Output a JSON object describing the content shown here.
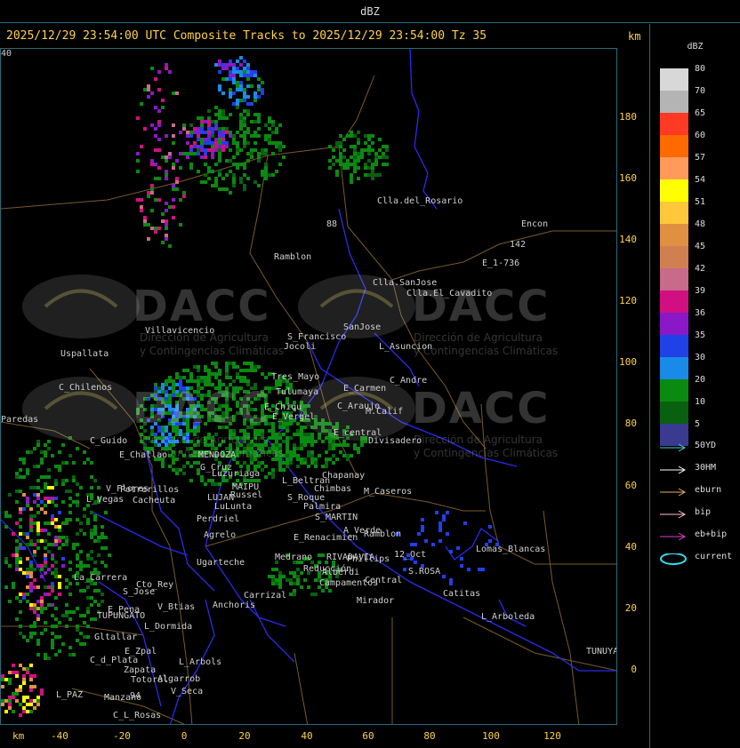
{
  "top_title": "dBZ",
  "header": {
    "title": "2025/12/29 23:54:00 UTC Composite Tracks to 2025/12/29 23:54:00 Tz 35",
    "km": "km"
  },
  "axes": {
    "x_unit": "km",
    "x_ticks": [
      "-40",
      "-20",
      "0",
      "20",
      "40",
      "60",
      "80",
      "100",
      "120"
    ],
    "y_ticks": [
      "180",
      "160",
      "140",
      "120",
      "100",
      "80",
      "60",
      "40",
      "20",
      "0"
    ]
  },
  "colorbar": {
    "title": "dBZ",
    "levels": [
      {
        "label": "80",
        "color": "#d8d8d8"
      },
      {
        "label": "70",
        "color": "#b4b4b4"
      },
      {
        "label": "65",
        "color": "#ff3a24"
      },
      {
        "label": "60",
        "color": "#ff6a00"
      },
      {
        "label": "57",
        "color": "#ff9a5a"
      },
      {
        "label": "54",
        "color": "#ffff00"
      },
      {
        "label": "51",
        "color": "#ffc83a"
      },
      {
        "label": "48",
        "color": "#e09040"
      },
      {
        "label": "45",
        "color": "#d08050"
      },
      {
        "label": "42",
        "color": "#c86a8a"
      },
      {
        "label": "39",
        "color": "#d01080"
      },
      {
        "label": "36",
        "color": "#8a18c8"
      },
      {
        "label": "35",
        "color": "#2040e8"
      },
      {
        "label": "30",
        "color": "#1a8ae8"
      },
      {
        "label": "20",
        "color": "#0a8a10"
      },
      {
        "label": "10",
        "color": "#096010"
      },
      {
        "label": "5",
        "color": "#3a3a90"
      }
    ]
  },
  "legend": [
    {
      "label": "50YD",
      "color": "#40d0e0",
      "kind": "arrow"
    },
    {
      "label": "30HM",
      "color": "#ffffff",
      "kind": "arrow"
    },
    {
      "label": "eburn",
      "color": "#e8b060",
      "kind": "arrow"
    },
    {
      "label": "bip",
      "color": "#ffc0d0",
      "kind": "arrow"
    },
    {
      "label": "eb+bip",
      "color": "#e040e0",
      "kind": "arrow"
    },
    {
      "label": "current",
      "color": "#30e0f0",
      "kind": "ellipse"
    }
  ],
  "watermark": {
    "brand": "DACC",
    "line1": "Dirección de Agricultura",
    "line2": "y Contingencias Climáticas"
  },
  "places": [
    {
      "name": "Clla.del_Rosario"
    },
    {
      "name": "Encon"
    },
    {
      "name": "142"
    },
    {
      "name": "E_1-736"
    },
    {
      "name": "Ramblon"
    },
    {
      "name": "Clla.SanJose"
    },
    {
      "name": "Clla.El_Cavadito"
    },
    {
      "name": "Villavicencio"
    },
    {
      "name": "S_Francisco"
    },
    {
      "name": "SanJose"
    },
    {
      "name": "L_Asuncion"
    },
    {
      "name": "Uspallata"
    },
    {
      "name": "Jocoli"
    },
    {
      "name": "Tres_Mayo"
    },
    {
      "name": "C_Andre"
    },
    {
      "name": "E_Carmen"
    },
    {
      "name": "Tulumaya"
    },
    {
      "name": "C_Chilenos"
    },
    {
      "name": "C_Araujo"
    },
    {
      "name": "E_Chiqu"
    },
    {
      "name": "M.Calif"
    },
    {
      "name": "E_Vergel"
    },
    {
      "name": "Paredas"
    },
    {
      "name": "E_central"
    },
    {
      "name": "Divisadero"
    },
    {
      "name": "C_Guido"
    },
    {
      "name": "E_Challao"
    },
    {
      "name": "MENDOZA"
    },
    {
      "name": "G_Cruz"
    },
    {
      "name": "Luzuriaga"
    },
    {
      "name": "L_Beltran"
    },
    {
      "name": "Chimbas"
    },
    {
      "name": "M_Caseros"
    },
    {
      "name": "Chapanay"
    },
    {
      "name": "Potrerillos"
    },
    {
      "name": "Cacheuta"
    },
    {
      "name": "L_Vegas"
    },
    {
      "name": "MAIPU"
    },
    {
      "name": "LUJAN"
    },
    {
      "name": "Russel"
    },
    {
      "name": "LuLunta"
    },
    {
      "name": "S_Roque"
    },
    {
      "name": "Palmira"
    },
    {
      "name": "Perdriel"
    },
    {
      "name": "S_MARTIN"
    },
    {
      "name": "A_Verde"
    },
    {
      "name": "Ramblon"
    },
    {
      "name": "Agrelo"
    },
    {
      "name": "E_Renacimien"
    },
    {
      "name": "Ugarteche"
    },
    {
      "name": "Medrano"
    },
    {
      "name": "RIVADAVIA"
    },
    {
      "name": "Phillips"
    },
    {
      "name": "12_Oct"
    },
    {
      "name": "Lomas_Blancas"
    },
    {
      "name": "Reducción"
    },
    {
      "name": "Alberdi"
    },
    {
      "name": "S.ROSA"
    },
    {
      "name": "La_Carrera"
    },
    {
      "name": "Cto_Rey"
    },
    {
      "name": "S_Jose"
    },
    {
      "name": "Carrizal"
    },
    {
      "name": "Campamentos"
    },
    {
      "name": "Central"
    },
    {
      "name": "Catitas"
    },
    {
      "name": "Mirador"
    },
    {
      "name": "V_Btias"
    },
    {
      "name": "Anchoris"
    },
    {
      "name": "E_Pena"
    },
    {
      "name": "TUPUNGATO"
    },
    {
      "name": "L_Arboleda"
    },
    {
      "name": "L_Dormida"
    },
    {
      "name": "Gltallar"
    },
    {
      "name": "E_Zpal"
    },
    {
      "name": "C_d_Plata"
    },
    {
      "name": "L_Arbols"
    },
    {
      "name": "Zapata"
    },
    {
      "name": "Algarrob"
    },
    {
      "name": "Totoral"
    },
    {
      "name": "V_Seca"
    },
    {
      "name": "TUNUYAN"
    },
    {
      "name": "L_PAZ"
    },
    {
      "name": "Manzano"
    },
    {
      "name": "94"
    },
    {
      "name": "C_L_Rosas"
    },
    {
      "name": "V_Flores"
    },
    {
      "name": "88"
    },
    {
      "name": "40"
    }
  ]
}
